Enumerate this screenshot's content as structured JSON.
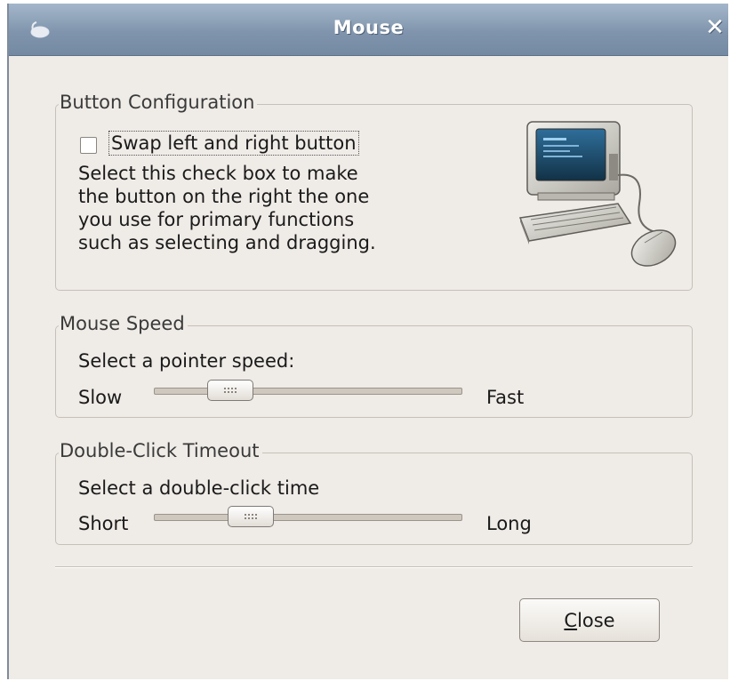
{
  "window": {
    "title": "Mouse",
    "close_glyph": "✕",
    "icon": "mouse-icon"
  },
  "button_config": {
    "group_label": "Button Configuration",
    "swap_checkbox": {
      "label": "Swap left and right button",
      "checked": false
    },
    "description_lines": [
      "Select this check box to make",
      "the button on the right the one",
      "you use for primary functions",
      "such as selecting and dragging."
    ],
    "illustration": "computer-with-mouse-icon"
  },
  "mouse_speed": {
    "group_label": "Mouse Speed",
    "prompt": "Select a pointer speed:",
    "min_label": "Slow",
    "max_label": "Fast",
    "value_fraction": 0.2
  },
  "double_click": {
    "group_label": "Double-Click Timeout",
    "prompt": "Select a double-click time",
    "min_label": "Short",
    "max_label": "Long",
    "value_fraction": 0.28
  },
  "footer": {
    "close_button_label_mnemonic": "C",
    "close_button_label_rest": "lose"
  },
  "colors": {
    "titlebar": "#8095ad",
    "background": "#efebe7",
    "title_text": "#ffffff"
  }
}
